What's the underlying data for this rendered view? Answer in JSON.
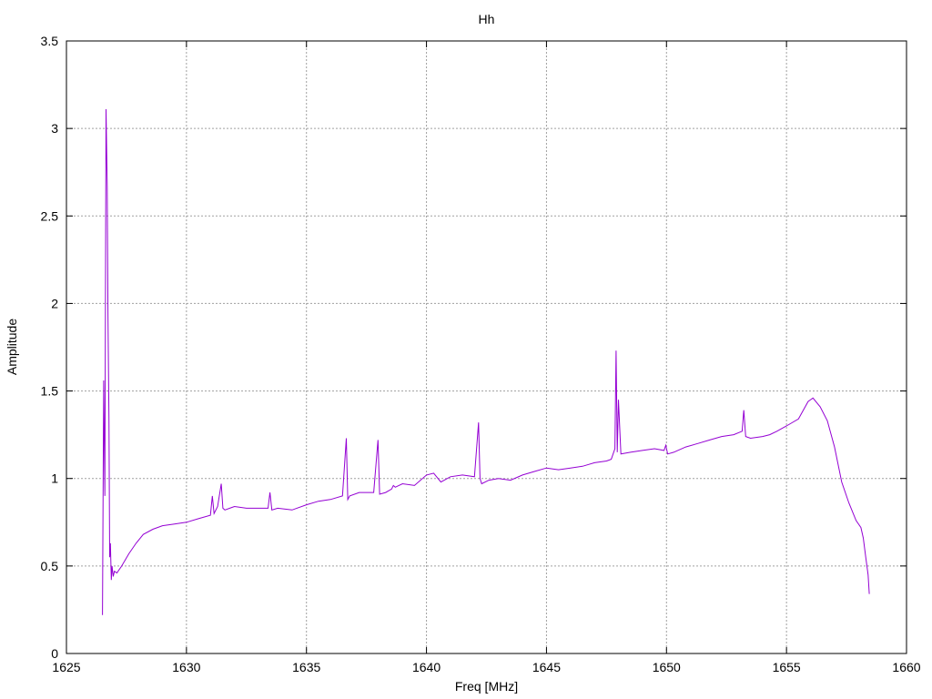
{
  "chart_data": {
    "type": "line",
    "title": "Hh",
    "xlabel": "Freq [MHz]",
    "ylabel": "Amplitude",
    "xlim": [
      1625,
      1660
    ],
    "ylim": [
      0,
      3.5
    ],
    "xticks": [
      "1625",
      "1630",
      "1635",
      "1640",
      "1645",
      "1650",
      "1655",
      "1660"
    ],
    "yticks": [
      "0",
      "0.5",
      "1",
      "1.5",
      "2",
      "2.5",
      "3",
      "3.5"
    ],
    "grid": true,
    "legend": "none",
    "series": [
      {
        "color": "#9400d3",
        "x": [
          1626.5,
          1626.55,
          1626.6,
          1626.65,
          1626.7,
          1626.73,
          1626.77,
          1626.8,
          1626.83,
          1626.87,
          1626.9,
          1626.95,
          1627.0,
          1627.1,
          1627.3,
          1627.6,
          1627.9,
          1628.2,
          1628.6,
          1629.0,
          1629.5,
          1630.0,
          1630.5,
          1631.0,
          1631.08,
          1631.15,
          1631.3,
          1631.45,
          1631.52,
          1631.6,
          1632.0,
          1632.5,
          1633.0,
          1633.4,
          1633.48,
          1633.56,
          1633.8,
          1634.4,
          1635.0,
          1635.5,
          1636.0,
          1636.5,
          1636.66,
          1636.72,
          1636.8,
          1637.2,
          1637.8,
          1637.98,
          1638.05,
          1638.3,
          1638.55,
          1638.62,
          1638.7,
          1639.0,
          1639.5,
          1640.0,
          1640.3,
          1640.6,
          1641.0,
          1641.5,
          1642.0,
          1642.17,
          1642.23,
          1642.3,
          1642.6,
          1643.0,
          1643.5,
          1644.0,
          1644.5,
          1645.0,
          1645.5,
          1646.0,
          1646.5,
          1647.0,
          1647.5,
          1647.7,
          1647.85,
          1647.9,
          1647.95,
          1648.0,
          1648.1,
          1648.5,
          1649.0,
          1649.5,
          1649.9,
          1649.97,
          1650.05,
          1650.3,
          1650.8,
          1651.3,
          1651.8,
          1652.3,
          1652.8,
          1653.15,
          1653.22,
          1653.3,
          1653.5,
          1654.0,
          1654.3,
          1654.6,
          1655.0,
          1655.5,
          1655.9,
          1656.1,
          1656.4,
          1656.7,
          1657.0,
          1657.3,
          1657.6,
          1657.9,
          1658.1,
          1658.2,
          1658.3,
          1658.4,
          1658.45
        ],
        "y": [
          0.22,
          1.56,
          0.9,
          3.11,
          2.67,
          1.95,
          1.35,
          0.55,
          0.63,
          0.42,
          0.5,
          0.44,
          0.47,
          0.46,
          0.5,
          0.57,
          0.63,
          0.68,
          0.71,
          0.73,
          0.74,
          0.75,
          0.77,
          0.79,
          0.9,
          0.8,
          0.84,
          0.97,
          0.83,
          0.82,
          0.84,
          0.83,
          0.83,
          0.83,
          0.92,
          0.82,
          0.83,
          0.82,
          0.85,
          0.87,
          0.88,
          0.9,
          1.23,
          0.88,
          0.9,
          0.92,
          0.92,
          1.22,
          0.91,
          0.92,
          0.94,
          0.96,
          0.95,
          0.97,
          0.96,
          1.02,
          1.03,
          0.98,
          1.01,
          1.02,
          1.01,
          1.32,
          1.0,
          0.97,
          0.99,
          1.0,
          0.99,
          1.02,
          1.04,
          1.06,
          1.05,
          1.06,
          1.07,
          1.09,
          1.1,
          1.11,
          1.17,
          1.73,
          1.15,
          1.45,
          1.14,
          1.15,
          1.16,
          1.17,
          1.16,
          1.19,
          1.14,
          1.15,
          1.18,
          1.2,
          1.22,
          1.24,
          1.25,
          1.27,
          1.39,
          1.24,
          1.23,
          1.24,
          1.25,
          1.27,
          1.3,
          1.34,
          1.44,
          1.46,
          1.41,
          1.33,
          1.18,
          0.98,
          0.86,
          0.76,
          0.72,
          0.66,
          0.55,
          0.45,
          0.34
        ]
      }
    ]
  }
}
